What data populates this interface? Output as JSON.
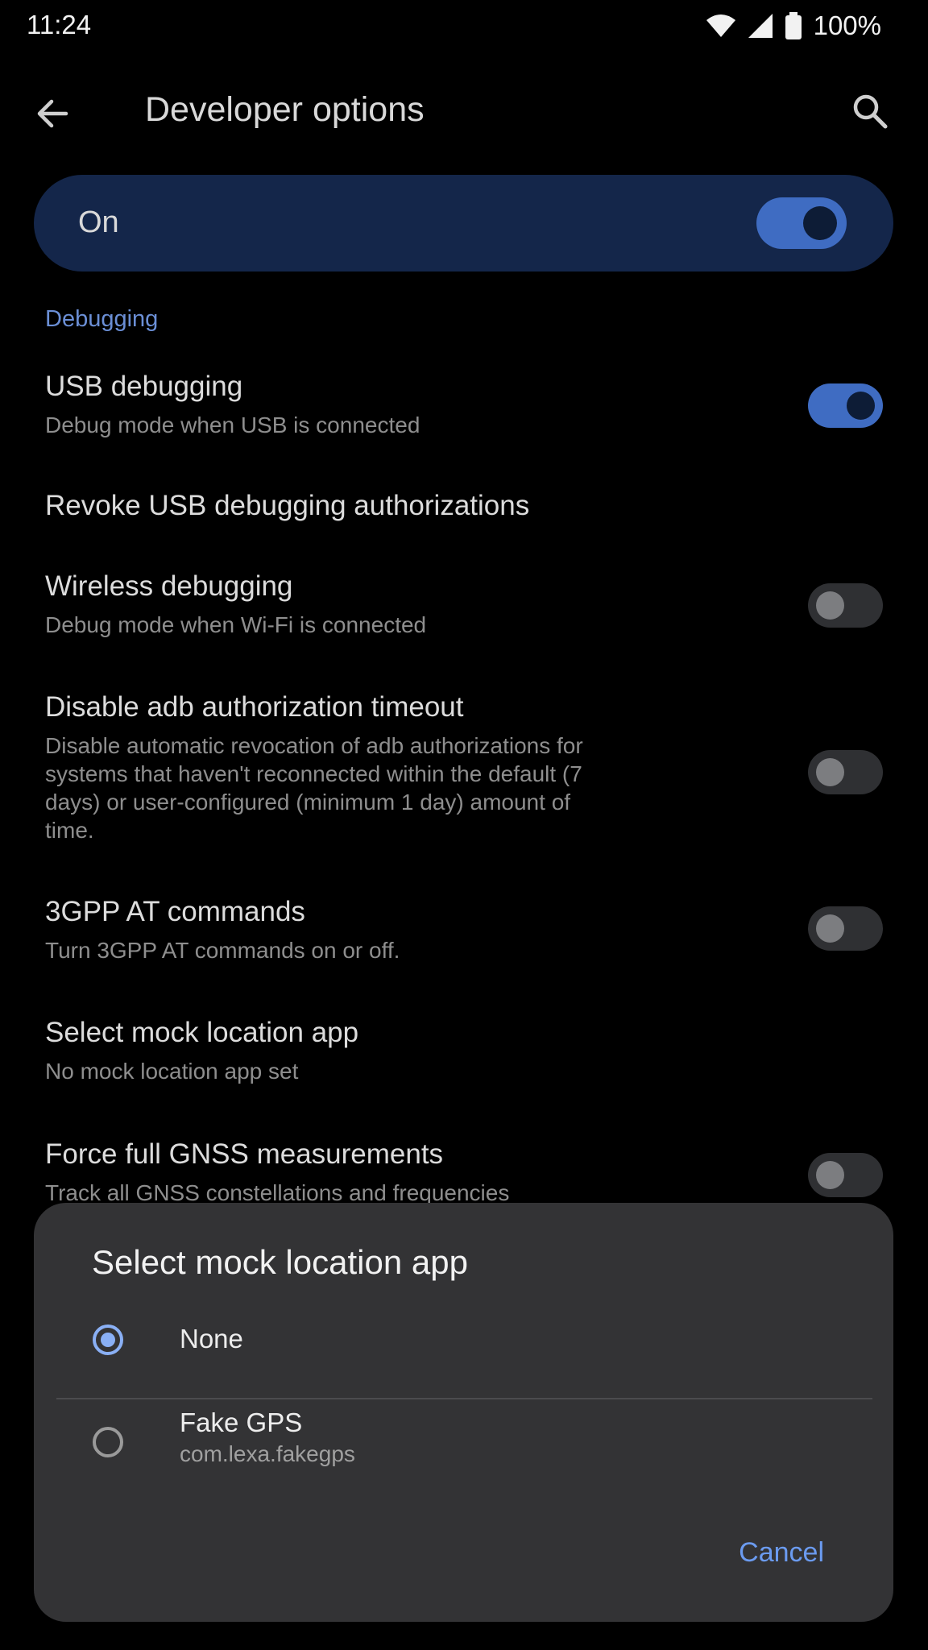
{
  "status_bar": {
    "time": "11:24",
    "battery": "100%",
    "icons": [
      "wifi-icon",
      "signal-icon",
      "battery-icon"
    ]
  },
  "header": {
    "title": "Developer options",
    "back_icon": "arrow-left-icon",
    "search_icon": "search-icon"
  },
  "master_switch": {
    "label": "On",
    "state": "on"
  },
  "debugging": {
    "section_title": "Debugging",
    "items": [
      {
        "title": "USB debugging",
        "summary": "Debug mode when USB is connected",
        "toggle": "on"
      },
      {
        "title": "Revoke USB debugging authorizations",
        "summary": ""
      },
      {
        "title": "Wireless debugging",
        "summary": "Debug mode when Wi-Fi is connected",
        "toggle": "off"
      },
      {
        "title": "Disable adb authorization timeout",
        "summary": "Disable automatic revocation of adb authorizations for systems that haven't reconnected within the default (7 days) or user-configured (minimum 1 day) amount of time.",
        "toggle": "off"
      },
      {
        "title": "3GPP AT commands",
        "summary": "Turn 3GPP AT commands on or off.",
        "toggle": "off"
      },
      {
        "title": "Select mock location app",
        "summary": "No mock location app set"
      },
      {
        "title": "Force full GNSS measurements",
        "summary": "Track all GNSS constellations and frequencies",
        "toggle": "off"
      }
    ]
  },
  "dialog": {
    "title": "Select mock location app",
    "options": [
      {
        "label": "None",
        "sub": "",
        "checked": true
      },
      {
        "label": "Fake GPS",
        "sub": "com.lexa.fakegps",
        "checked": false
      }
    ],
    "cancel_label": "Cancel"
  },
  "colors": {
    "accent": "#6b9bf0",
    "toggle_on": "#3f6cc2",
    "master_switch_bg": "#14264a",
    "dialog_bg": "#333335"
  }
}
